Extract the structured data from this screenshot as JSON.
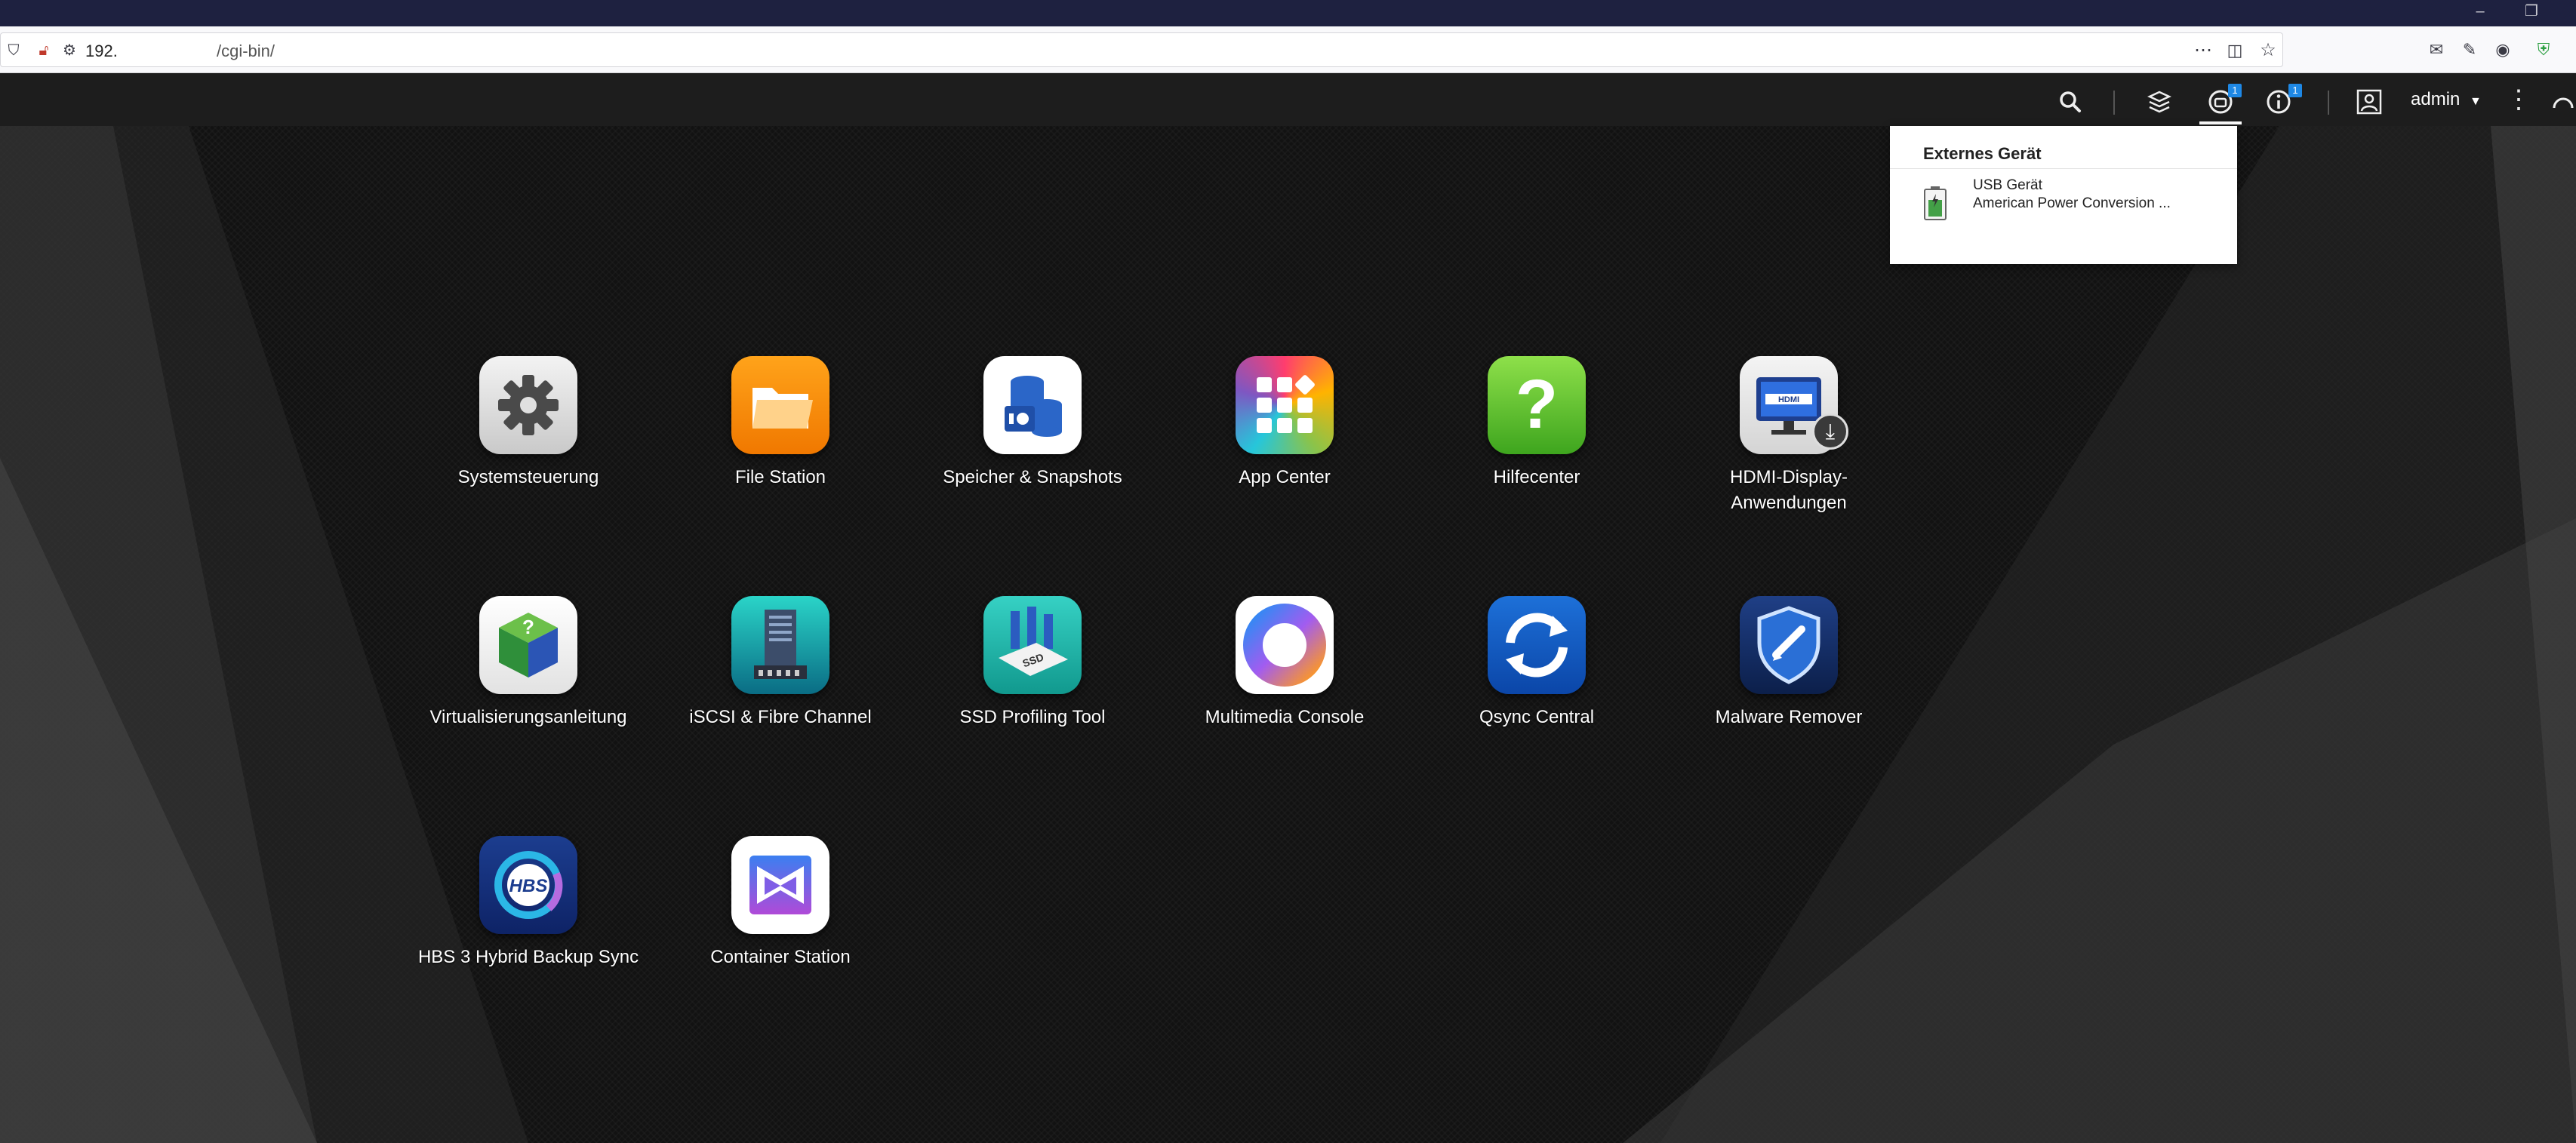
{
  "browser": {
    "url_host": "192.",
    "url_path": "/cgi-bin/",
    "window_controls": {
      "minimize": "–",
      "restore": "❐"
    }
  },
  "topbar": {
    "user_name": "admin",
    "badges": {
      "tasks": "1",
      "info": "1"
    }
  },
  "apps": [
    {
      "id": "systemsteuerung",
      "label": "Systemsteuerung",
      "icon": "gear-icon"
    },
    {
      "id": "file-station",
      "label": "File Station",
      "icon": "folder-icon"
    },
    {
      "id": "speicher-snapshots",
      "label": "Speicher & Snapshots",
      "icon": "database-icon"
    },
    {
      "id": "app-center",
      "label": "App Center",
      "icon": "grid-icon"
    },
    {
      "id": "hilfecenter",
      "label": "Hilfecenter",
      "icon": "question-icon"
    },
    {
      "id": "hdmi-display",
      "label": "HDMI-Display-Anwendungen",
      "icon": "monitor-icon"
    },
    {
      "id": "virtualisierung",
      "label": "Virtualisierungsanleitung",
      "icon": "cube-icon"
    },
    {
      "id": "iscsi",
      "label": "iSCSI & Fibre Channel",
      "icon": "server-icon"
    },
    {
      "id": "ssd-profiling",
      "label": "SSD Profiling Tool",
      "icon": "ssd-icon"
    },
    {
      "id": "multimedia-console",
      "label": "Multimedia Console",
      "icon": "aperture-icon"
    },
    {
      "id": "qsync-central",
      "label": "Qsync Central",
      "icon": "sync-icon"
    },
    {
      "id": "malware-remover",
      "label": "Malware Remover",
      "icon": "shield-icon"
    },
    {
      "id": "hbs3",
      "label": "HBS 3 Hybrid Backup Sync",
      "icon": "hbs-icon"
    },
    {
      "id": "container-station",
      "label": "Container Station",
      "icon": "container-icon"
    }
  ],
  "external_device_panel": {
    "title": "Externes Gerät",
    "device_name": "USB Gerät",
    "device_desc": "American Power Conversion ..."
  },
  "colors": {
    "titlebar": "#1e2140",
    "topbar": "#1d1d1d",
    "badge": "#1e88e5",
    "desktop": "#121212"
  }
}
